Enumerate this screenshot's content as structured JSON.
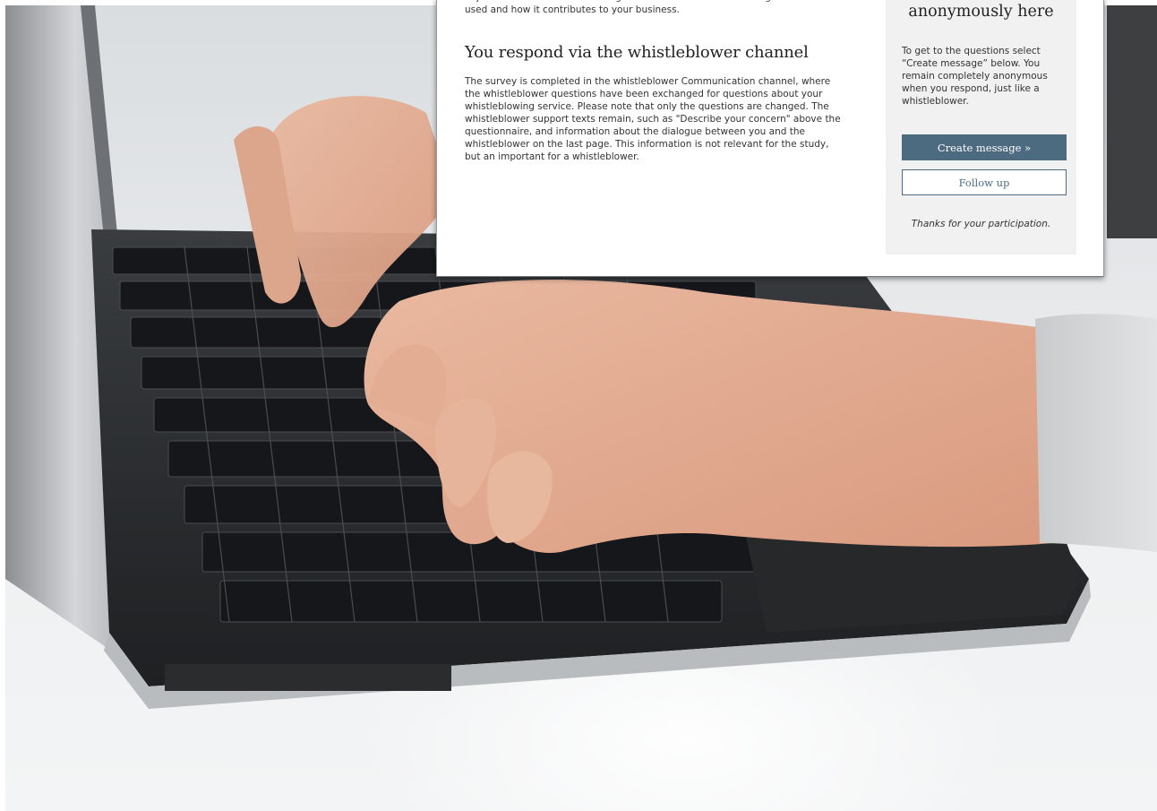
{
  "card": {
    "intro_text": "objective is to increase knowledge about how the whistleblowing service is used and how it contributes to your business.",
    "section_title": "You respond via the whistleblower channel",
    "body_text": "The survey is completed in the whistleblower Communication channel, where the whistleblower questions have been exchanged for questions about your whistleblowing service. Please note that only the questions are changed. The whistleblower support texts remain, such as \"Describe your concern\" above the questionnaire, and information about the dialogue between you and the whistleblower on the last page. This information is not relevant for the study, but an important for a whistleblower."
  },
  "sidebar": {
    "heading": "anonymously here",
    "text": "To get to the questions select “Create message” below. You remain completely anonymous when you respond, just like a whistleblower.",
    "create_button_label": "Create message »",
    "follow_up_button_label": "Follow up",
    "thanks_text": "Thanks for your participation."
  },
  "colors": {
    "primary_button": "#4d6b80",
    "sidebar_background": "#f1f1f1"
  }
}
